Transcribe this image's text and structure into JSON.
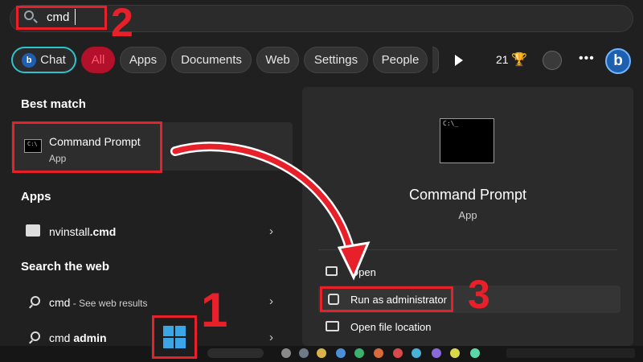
{
  "search": {
    "query": "cmd"
  },
  "annotations": {
    "step1": "1",
    "step2": "2",
    "step3": "3"
  },
  "filters": [
    "Chat",
    "All",
    "Apps",
    "Documents",
    "Web",
    "Settings",
    "People"
  ],
  "top_right": {
    "points": "21"
  },
  "best_match": {
    "header": "Best match",
    "title": "Command Prompt",
    "subtitle": "App"
  },
  "apps": {
    "header": "Apps",
    "items": [
      {
        "name": "nvinstall",
        "ext": ".cmd"
      }
    ]
  },
  "web": {
    "header": "Search the web",
    "items": [
      {
        "query": "cmd",
        "suffix": " - See web results"
      },
      {
        "query_prefix": "cmd ",
        "query_bold": "admin"
      }
    ]
  },
  "detail": {
    "title": "Command Prompt",
    "subtitle": "App",
    "actions": [
      "Open",
      "Run as administrator",
      "Open file location"
    ]
  },
  "colors": {
    "annotation_red": "#e8202a",
    "chat_outline": "#2ec4cf",
    "all_chip": "#b3102b"
  }
}
